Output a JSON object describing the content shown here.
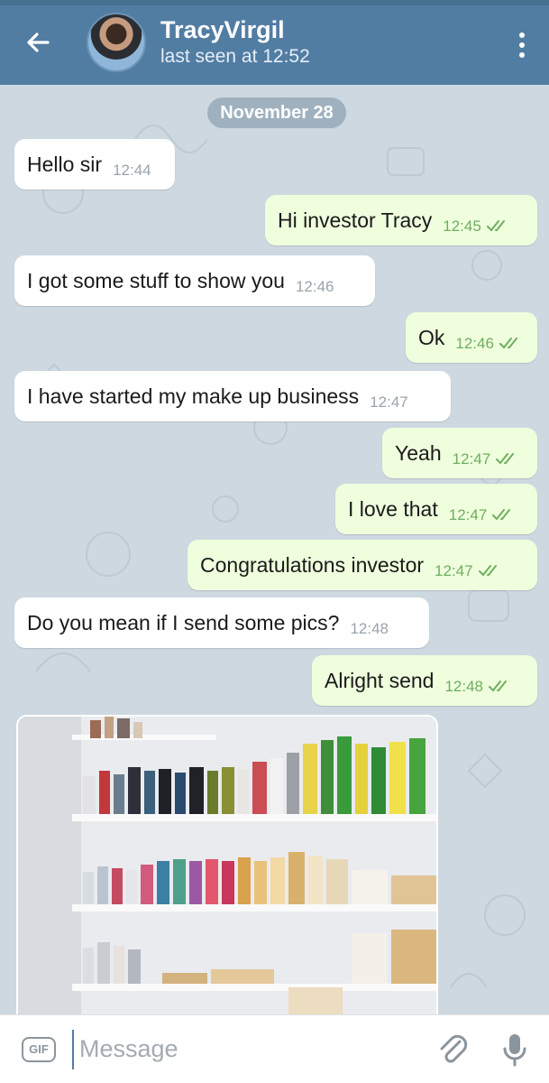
{
  "header": {
    "contact_name": "TracyVirgil",
    "status": "last seen at 12:52"
  },
  "date_pill": "November 28",
  "messages": [
    {
      "dir": "in",
      "text": "Hello sir",
      "time": "12:44"
    },
    {
      "dir": "out",
      "text": "Hi investor Tracy",
      "time": "12:45",
      "read": true
    },
    {
      "dir": "in",
      "text": "I got some stuff to show you",
      "time": "12:46"
    },
    {
      "dir": "out",
      "text": "Ok",
      "time": "12:46",
      "read": true
    },
    {
      "dir": "in",
      "text": "I have started my make up business",
      "time": "12:47"
    },
    {
      "dir": "out",
      "text": "Yeah",
      "time": "12:47",
      "read": true
    },
    {
      "dir": "out",
      "text": "I love that",
      "time": "12:47",
      "read": true
    },
    {
      "dir": "out",
      "text": "Congratulations investor",
      "time": "12:47",
      "read": true
    },
    {
      "dir": "in",
      "text": "Do you mean if I send some pics?",
      "time": "12:48"
    },
    {
      "dir": "out",
      "text": "Alright send",
      "time": "12:48",
      "read": true
    }
  ],
  "input": {
    "gif_label": "GIF",
    "placeholder": "Message"
  },
  "colors": {
    "header": "#527da3",
    "outgoing_bubble": "#effedd",
    "incoming_bubble": "#ffffff",
    "chat_background": "#cdd8e0",
    "read_ticks": "#6fae60"
  },
  "icons": {
    "back": "arrow-left-icon",
    "menu": "more-vert-icon",
    "attach": "paperclip-icon",
    "mic": "microphone-icon",
    "ticks": "double-check-icon"
  }
}
